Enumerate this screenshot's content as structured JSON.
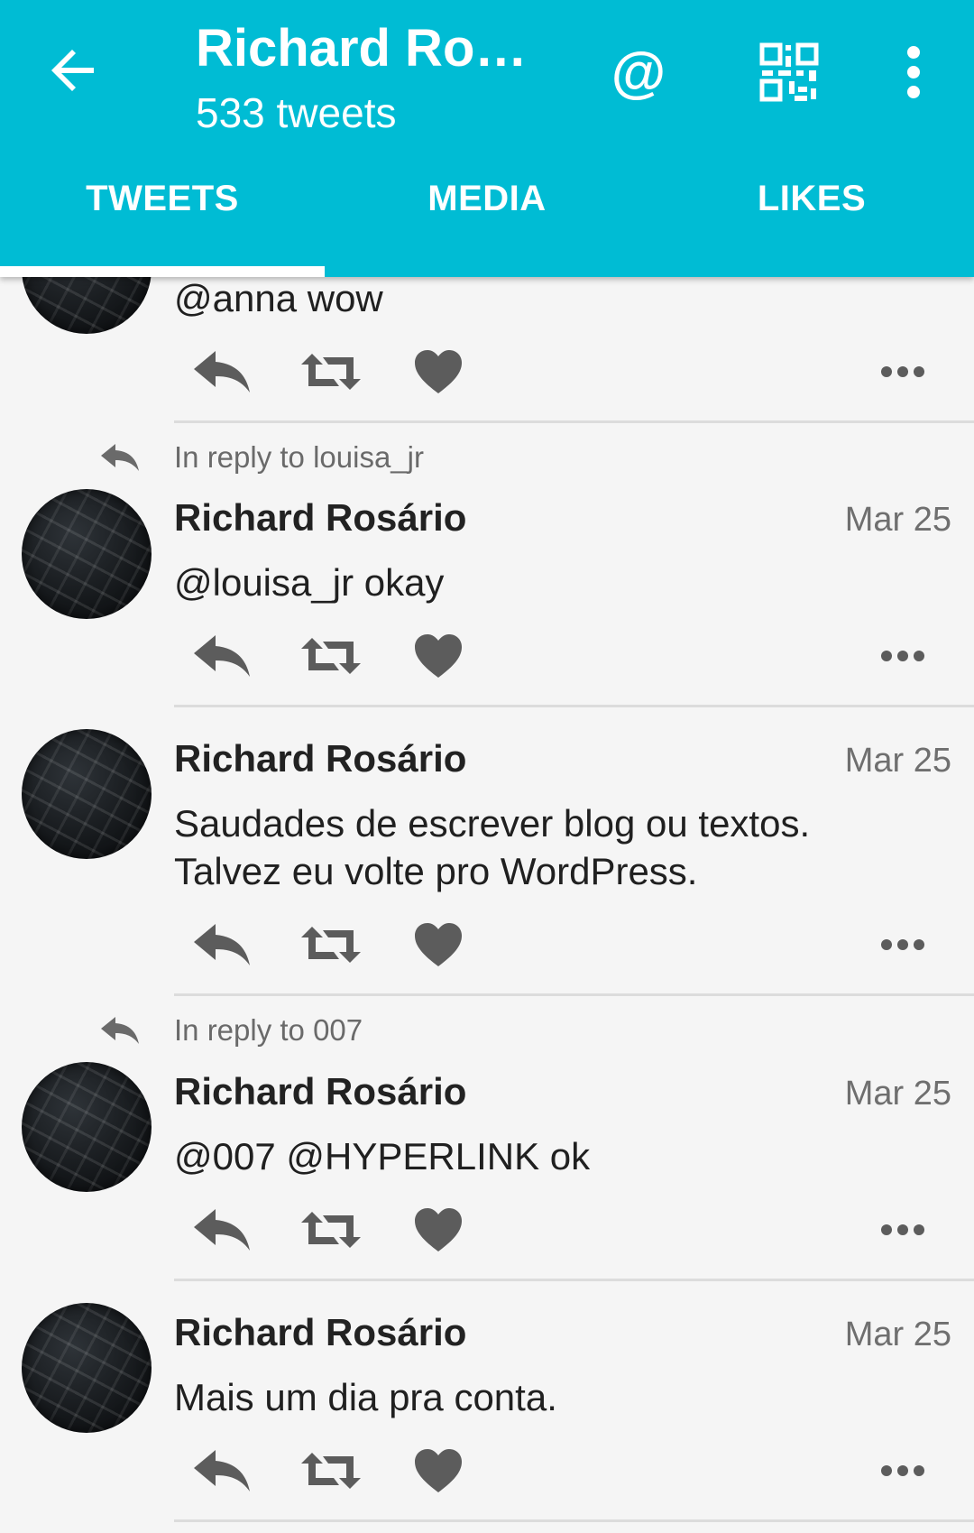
{
  "header": {
    "title": "Richard Ros…",
    "subtitle": "533 tweets",
    "at_symbol": "@",
    "icons": [
      "back-arrow-icon",
      "mention-icon",
      "qr-code-icon",
      "overflow-menu-icon"
    ],
    "accent_color": "#00bcd4"
  },
  "tabs": [
    {
      "label": "TWEETS",
      "selected": true
    },
    {
      "label": "MEDIA",
      "selected": false
    },
    {
      "label": "LIKES",
      "selected": false
    }
  ],
  "tweets": [
    {
      "text": "@anna wow"
    },
    {
      "reply_to": "In reply to louisa_jr",
      "author": "Richard Rosário",
      "date": "Mar 25",
      "text": "@louisa_jr okay"
    },
    {
      "author": "Richard Rosário",
      "date": "Mar 25",
      "text": "Saudades de escrever blog ou textos. Talvez eu volte pro WordPress."
    },
    {
      "reply_to": "In reply to 007",
      "author": "Richard Rosário",
      "date": "Mar 25",
      "text": "@007 @HYPERLINK ok"
    },
    {
      "author": "Richard Rosário",
      "date": "Mar 25",
      "text": "Mais um dia pra conta."
    }
  ]
}
